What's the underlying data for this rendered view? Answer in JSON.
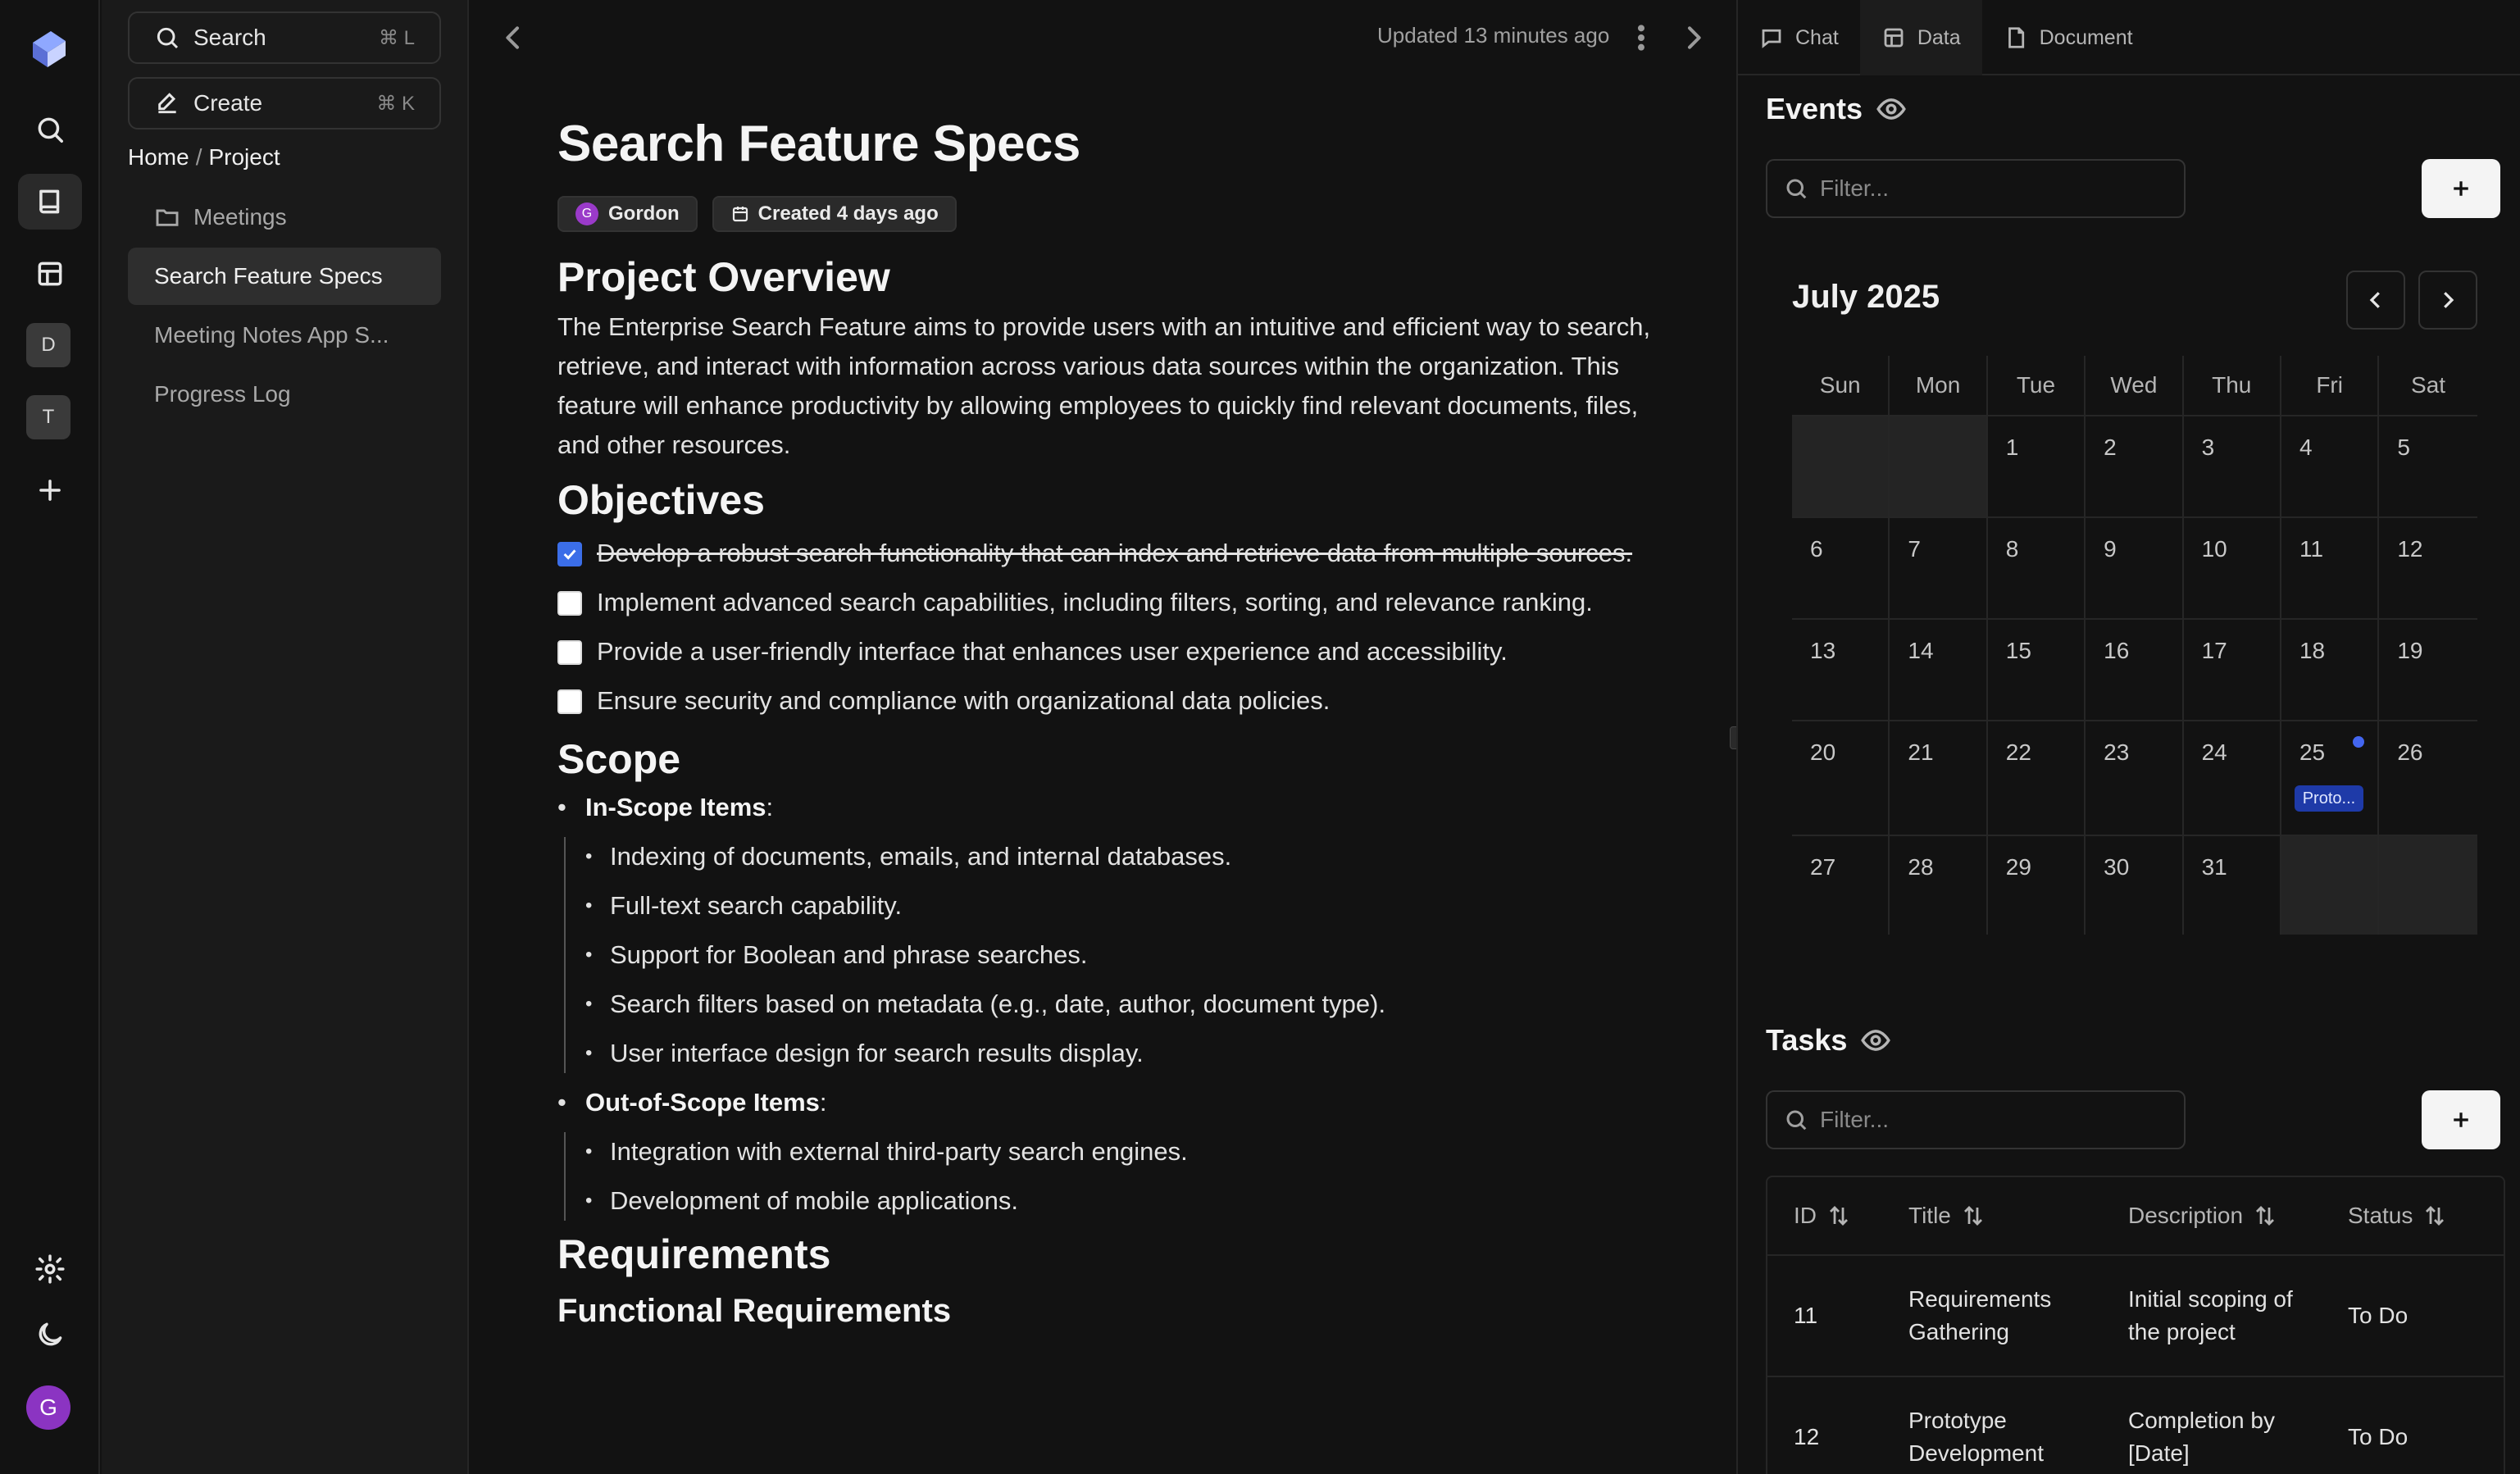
{
  "sidebar": {
    "search_label": "Search",
    "search_kbd": "⌘ L",
    "create_label": "Create",
    "create_kbd": "⌘ K",
    "breadcrumb": {
      "home": "Home",
      "sep": "/",
      "current": "Project"
    },
    "items": [
      {
        "label": "Meetings",
        "icon": "folder-icon"
      },
      {
        "label": "Search Feature Specs",
        "active": true
      },
      {
        "label": "Meeting Notes App S..."
      },
      {
        "label": "Progress Log"
      }
    ]
  },
  "rail": {
    "workspaces": [
      "D",
      "T"
    ],
    "user_initial": "G"
  },
  "topbar": {
    "updated": "Updated 13 minutes ago"
  },
  "doc": {
    "title": "Search Feature Specs",
    "author": "Gordon",
    "author_initial": "G",
    "created": "Created 4 days ago",
    "overview_heading": "Project Overview",
    "overview_text": "The Enterprise Search Feature aims to provide users with an intuitive and efficient way to search, retrieve, and interact with information across various data sources within the organization. This feature will enhance productivity by allowing employees to quickly find relevant documents, files, and other resources.",
    "objectives_heading": "Objectives",
    "objectives": [
      {
        "text": "Develop a robust search functionality that can index and retrieve data from multiple sources.",
        "checked": true
      },
      {
        "text": "Implement advanced search capabilities, including filters, sorting, and relevance ranking.",
        "checked": false
      },
      {
        "text": "Provide a user-friendly interface that enhances user experience and accessibility.",
        "checked": false
      },
      {
        "text": "Ensure security and compliance with organizational data policies.",
        "checked": false
      }
    ],
    "scope_heading": "Scope",
    "in_scope_label": "In-Scope Items",
    "in_scope": [
      "Indexing of documents, emails, and internal databases.",
      "Full-text search capability.",
      "Support for Boolean and phrase searches.",
      "Search filters based on metadata (e.g., date, author, document type).",
      "User interface design for search results display."
    ],
    "out_scope_label": "Out-of-Scope Items",
    "out_scope": [
      "Integration with external third-party search engines.",
      "Development of mobile applications."
    ],
    "requirements_heading": "Requirements",
    "functional_heading": "Functional Requirements"
  },
  "right": {
    "tabs": [
      "Chat",
      "Data",
      "Document"
    ],
    "events_title": "Events",
    "filter_placeholder": "Filter...",
    "month": "July 2025",
    "weekdays": [
      "Sun",
      "Mon",
      "Tue",
      "Wed",
      "Thu",
      "Fri",
      "Sat"
    ],
    "event_chip": "Proto...",
    "tasks_title": "Tasks",
    "tasks_columns": [
      "ID",
      "Title",
      "Description",
      "Status"
    ],
    "tasks": [
      {
        "id": "11",
        "title": "Requirements Gathering",
        "description": "Initial scoping of the project",
        "status": "To Do"
      },
      {
        "id": "12",
        "title": "Prototype Development",
        "description": "Completion by [Date]",
        "status": "To Do"
      }
    ]
  }
}
